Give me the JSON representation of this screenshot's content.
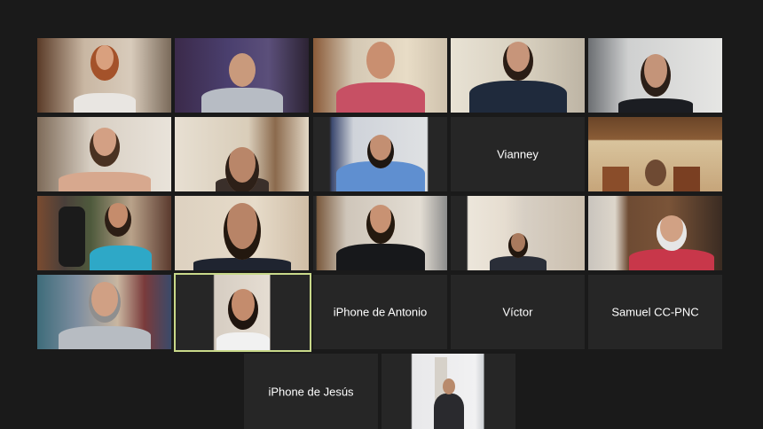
{
  "participants": [
    {
      "id": "p1",
      "label": ""
    },
    {
      "id": "p2",
      "label": ""
    },
    {
      "id": "p3",
      "label": ""
    },
    {
      "id": "p4",
      "label": ""
    },
    {
      "id": "p5",
      "label": ""
    },
    {
      "id": "p6",
      "label": ""
    },
    {
      "id": "p7",
      "label": ""
    },
    {
      "id": "p8",
      "label": ""
    },
    {
      "id": "p9",
      "label": "Vianney"
    },
    {
      "id": "p10",
      "label": ""
    },
    {
      "id": "p11",
      "label": ""
    },
    {
      "id": "p12",
      "label": ""
    },
    {
      "id": "p13",
      "label": ""
    },
    {
      "id": "p14",
      "label": ""
    },
    {
      "id": "p15",
      "label": ""
    },
    {
      "id": "p16",
      "label": ""
    },
    {
      "id": "p17",
      "label": ""
    },
    {
      "id": "p18",
      "label": "iPhone de Antonio"
    },
    {
      "id": "p19",
      "label": "Víctor"
    },
    {
      "id": "p20",
      "label": "Samuel CC-PNC"
    },
    {
      "id": "p21",
      "label": "iPhone de Jesús"
    },
    {
      "id": "p22",
      "label": ""
    }
  ]
}
